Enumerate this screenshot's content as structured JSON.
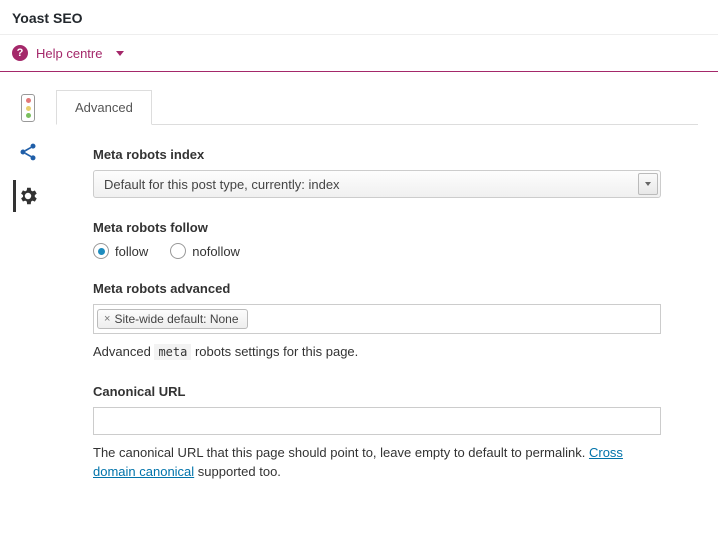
{
  "header": {
    "title": "Yoast SEO"
  },
  "help": {
    "label": "Help centre"
  },
  "sidebar": {
    "items": [
      {
        "name": "readability-traffic-light"
      },
      {
        "name": "share-icon"
      },
      {
        "name": "gear-icon"
      }
    ],
    "active": "gear-icon"
  },
  "tabs": {
    "active": "Advanced"
  },
  "fields": {
    "robots_index": {
      "label": "Meta robots index",
      "value": "Default for this post type, currently: index"
    },
    "robots_follow": {
      "label": "Meta robots follow",
      "options": {
        "follow": "follow",
        "nofollow": "nofollow"
      },
      "selected": "follow"
    },
    "robots_advanced": {
      "label": "Meta robots advanced",
      "token": "Site-wide default: None",
      "helper_pre": "Advanced ",
      "helper_code": "meta",
      "helper_post": " robots settings for this page."
    },
    "canonical": {
      "label": "Canonical URL",
      "value": "",
      "helper_pre": "The canonical URL that this page should point to, leave empty to default to permalink. ",
      "helper_link": "Cross domain canonical",
      "helper_post": " supported too."
    }
  }
}
